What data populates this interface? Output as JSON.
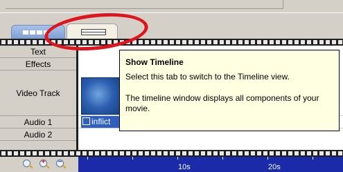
{
  "tabs": [
    {
      "name": "storyboard",
      "icon": "storyboard-icon"
    },
    {
      "name": "timeline",
      "icon": "timeline-icon",
      "active": true
    }
  ],
  "tracks": [
    "Text",
    "Effects",
    "Video Track",
    "Audio 1",
    "Audio 2"
  ],
  "audio_clip": {
    "label": "inflict"
  },
  "ruler": {
    "labels": [
      "10s",
      "20s"
    ]
  },
  "tooltip": {
    "title": "Show Timeline",
    "line1": "Select this tab to switch to the Timeline view.",
    "line2": "The timeline window displays all components of your movie."
  },
  "zoom_buttons": [
    "zoom-fit-icon",
    "zoom-in-icon",
    "zoom-out-icon"
  ],
  "colors": {
    "highlight_ring": "#e0141e",
    "tooltip_bg": "#ffffe1",
    "ruler_bg": "#1a2aa8",
    "clip_bg": "#2f5fbf"
  }
}
